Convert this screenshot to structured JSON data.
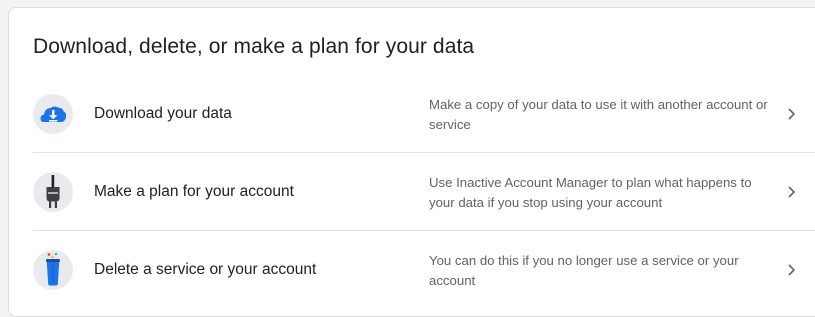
{
  "card": {
    "title": "Download, delete, or make a plan for your data"
  },
  "rows": [
    {
      "label": "Download your data",
      "description": "Make a copy of your data to use it with another account or service",
      "icon": "cloud-download-icon"
    },
    {
      "label": "Make a plan for your account",
      "description": "Use Inactive Account Manager to plan what happens to your data if you stop using your account",
      "icon": "power-plug-icon"
    },
    {
      "label": "Delete a service or your account",
      "description": "You can do this if you no longer use a service or your account",
      "icon": "trash-can-icon"
    }
  ],
  "colors": {
    "primary_text": "#202124",
    "secondary_text": "#5f6368",
    "divider": "#e0e0e0",
    "google_blue": "#1a73e8",
    "icon_circle": "#e8eaed"
  },
  "chevron_icon": "chevron-right-icon"
}
